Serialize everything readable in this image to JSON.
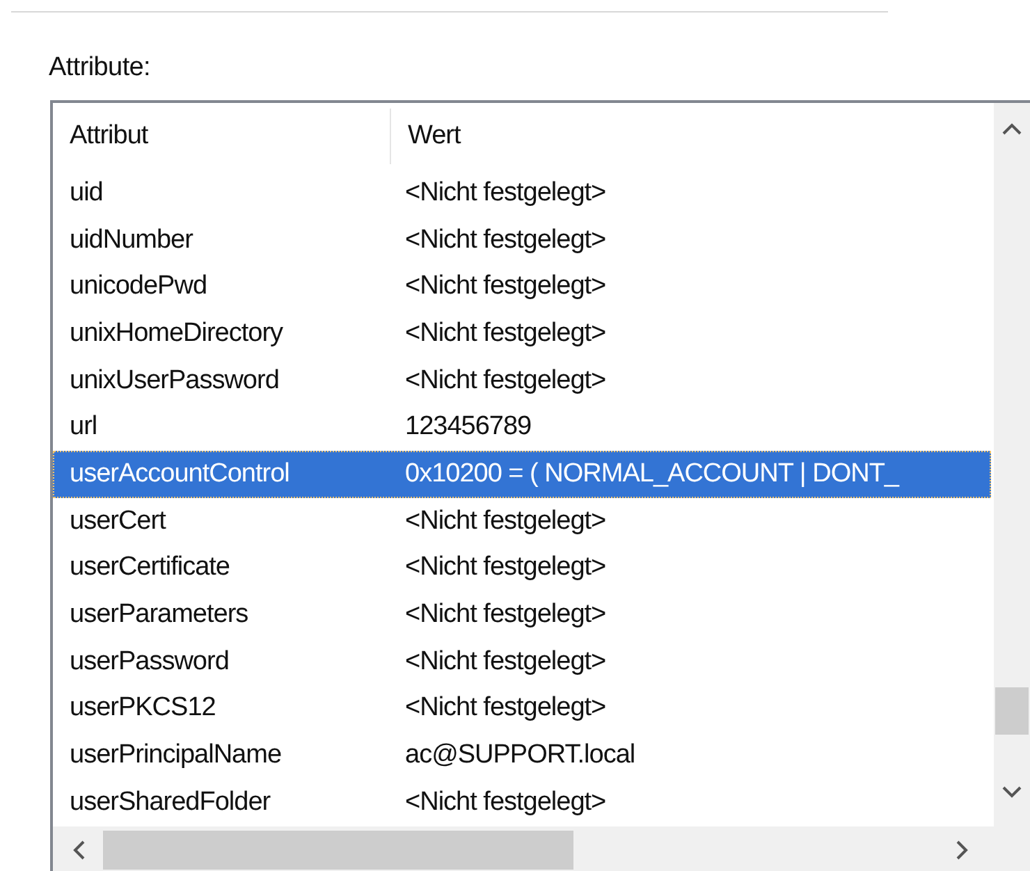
{
  "label": "Attribute:",
  "columns": [
    "Attribut",
    "Wert"
  ],
  "rows": [
    {
      "name": "uid",
      "value": "<Nicht festgelegt>",
      "selected": false
    },
    {
      "name": "uidNumber",
      "value": "<Nicht festgelegt>",
      "selected": false
    },
    {
      "name": "unicodePwd",
      "value": "<Nicht festgelegt>",
      "selected": false
    },
    {
      "name": "unixHomeDirectory",
      "value": "<Nicht festgelegt>",
      "selected": false
    },
    {
      "name": "unixUserPassword",
      "value": "<Nicht festgelegt>",
      "selected": false
    },
    {
      "name": "url",
      "value": "123456789",
      "selected": false
    },
    {
      "name": "userAccountControl",
      "value": "0x10200 = ( NORMAL_ACCOUNT | DONT_",
      "selected": true
    },
    {
      "name": "userCert",
      "value": "<Nicht festgelegt>",
      "selected": false
    },
    {
      "name": "userCertificate",
      "value": "<Nicht festgelegt>",
      "selected": false
    },
    {
      "name": "userParameters",
      "value": "<Nicht festgelegt>",
      "selected": false
    },
    {
      "name": "userPassword",
      "value": "<Nicht festgelegt>",
      "selected": false
    },
    {
      "name": "userPKCS12",
      "value": "<Nicht festgelegt>",
      "selected": false
    },
    {
      "name": "userPrincipalName",
      "value": "ac@SUPPORT.local",
      "selected": false
    },
    {
      "name": "userSharedFolder",
      "value": "<Nicht festgelegt>",
      "selected": false
    }
  ]
}
